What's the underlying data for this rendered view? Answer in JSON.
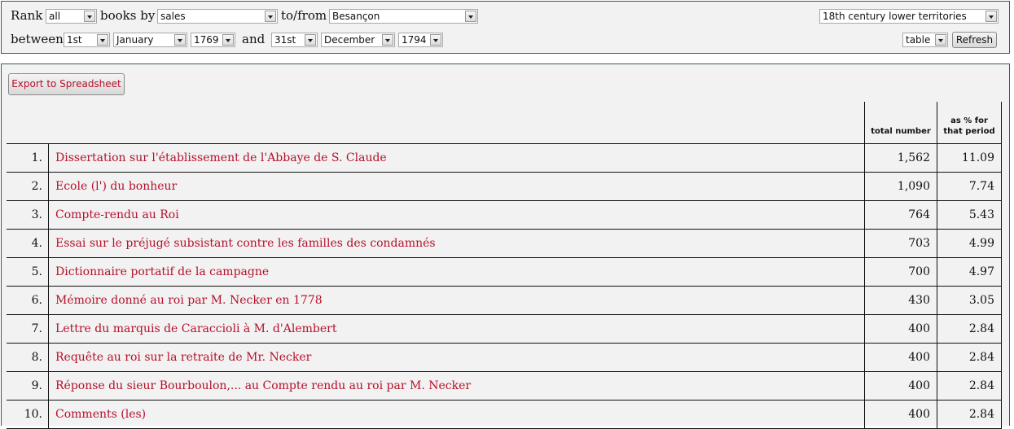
{
  "controls": {
    "rank_label": "Rank",
    "rank_value": "all",
    "books_by_label": "books by",
    "books_by_value": "sales",
    "to_from_label": "to/from",
    "to_from_value": "Besançon",
    "territory_value": "18th century lower territories",
    "between_label": "between",
    "start_day": "1st",
    "start_month": "January",
    "start_year": "1769",
    "and_label": "and",
    "end_day": "31st",
    "end_month": "December",
    "end_year": "1794",
    "view_value": "table",
    "refresh_label": "Refresh"
  },
  "export_label": "Export to Spreadsheet",
  "table": {
    "headers": {
      "total": "total number",
      "pct_line1": "as % for",
      "pct_line2": "that period"
    },
    "rows": [
      {
        "rank": "1.",
        "title": "Dissertation sur l'établissement de l'Abbaye de S. Claude",
        "total": "1,562",
        "pct": "11.09"
      },
      {
        "rank": "2.",
        "title": "Ecole (l') du bonheur",
        "total": "1,090",
        "pct": "7.74"
      },
      {
        "rank": "3.",
        "title": "Compte-rendu au Roi",
        "total": "764",
        "pct": "5.43"
      },
      {
        "rank": "4.",
        "title": "Essai sur le préjugé subsistant contre les familles des condamnés",
        "total": "703",
        "pct": "4.99"
      },
      {
        "rank": "5.",
        "title": "Dictionnaire portatif de la campagne",
        "total": "700",
        "pct": "4.97"
      },
      {
        "rank": "6.",
        "title": "Mémoire donné au roi par M. Necker en 1778",
        "total": "430",
        "pct": "3.05"
      },
      {
        "rank": "7.",
        "title": "Lettre du marquis de Caraccioli à M. d'Alembert",
        "total": "400",
        "pct": "2.84"
      },
      {
        "rank": "8.",
        "title": "Requête au roi sur la retraite de Mr. Necker",
        "total": "400",
        "pct": "2.84"
      },
      {
        "rank": "9.",
        "title": "Réponse du sieur Bourboulon,... au Compte rendu au roi par M. Necker",
        "total": "400",
        "pct": "2.84"
      },
      {
        "rank": "10.",
        "title": "Comments (les)",
        "total": "400",
        "pct": "2.84"
      }
    ]
  }
}
